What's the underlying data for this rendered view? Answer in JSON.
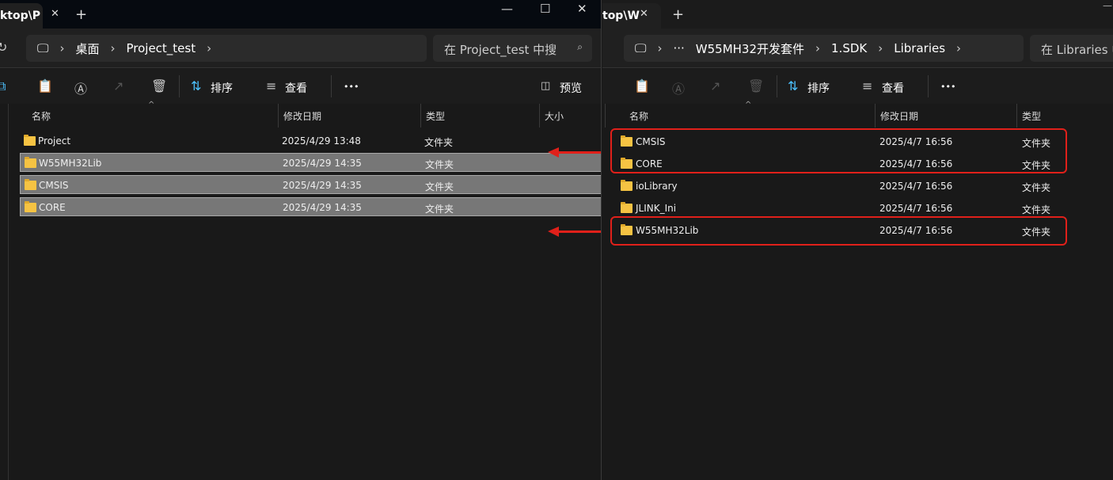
{
  "left": {
    "tab_title": "ktop\\P",
    "tab_close": "✕",
    "new_tab": "+",
    "window_controls": [
      "—",
      "☐",
      "✕"
    ],
    "breadcrumb": [
      "桌面",
      "Project_test"
    ],
    "search_placeholder": "在 Project_test 中搜",
    "toolbar": {
      "sort": "排序",
      "view": "查看",
      "more": "•••",
      "preview": "预览"
    },
    "columns": [
      "名称",
      "修改日期",
      "类型",
      "大小"
    ],
    "rows": [
      {
        "name": "Project",
        "date": "2025/4/29 13:48",
        "type": "文件夹",
        "selected": false
      },
      {
        "name": "W55MH32Lib",
        "date": "2025/4/29 14:35",
        "type": "文件夹",
        "selected": true
      },
      {
        "name": "CMSIS",
        "date": "2025/4/29 14:35",
        "type": "文件夹",
        "selected": true
      },
      {
        "name": "CORE",
        "date": "2025/4/29 14:35",
        "type": "文件夹",
        "selected": true
      }
    ]
  },
  "right": {
    "tab_title": "top\\W",
    "tab_close": "✕",
    "new_tab": "+",
    "breadcrumb": [
      "···",
      "W55MH32开发套件",
      "1.SDK",
      "Libraries"
    ],
    "search_placeholder": "在 Libraries 中",
    "toolbar": {
      "sort": "排序",
      "view": "查看",
      "more": "•••"
    },
    "columns": [
      "名称",
      "修改日期",
      "类型"
    ],
    "rows": [
      {
        "name": "CMSIS",
        "date": "2025/4/7 16:56",
        "type": "文件夹"
      },
      {
        "name": "CORE",
        "date": "2025/4/7 16:56",
        "type": "文件夹"
      },
      {
        "name": "ioLibrary",
        "date": "2025/4/7 16:56",
        "type": "文件夹"
      },
      {
        "name": "JLINK_Ini",
        "date": "2025/4/7 16:56",
        "type": "文件夹"
      },
      {
        "name": "W55MH32Lib",
        "date": "2025/4/7 16:56",
        "type": "文件夹"
      }
    ]
  },
  "annotation_color": "#e0201a"
}
